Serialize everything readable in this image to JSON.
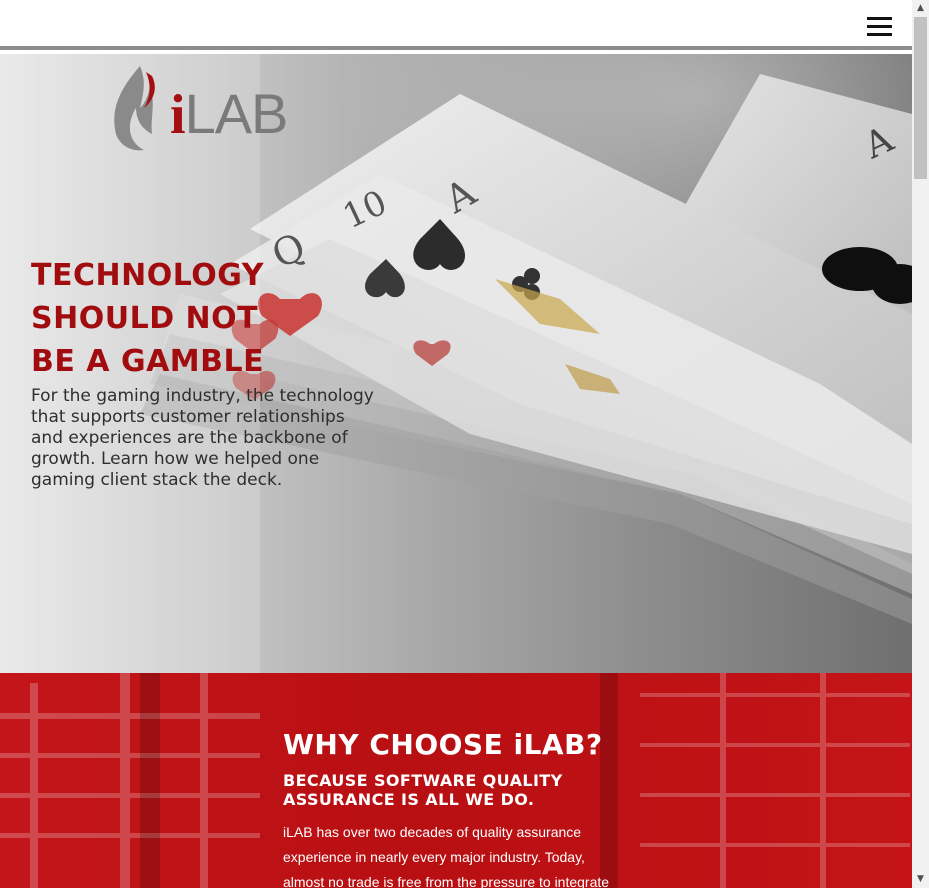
{
  "header": {
    "menu_icon": "hamburger-menu-icon"
  },
  "hero": {
    "logo": {
      "brand_prefix": "i",
      "brand_rest": "LAB",
      "flame_icon": "flame-icon"
    },
    "title_lines": [
      "TECHNOLOGY",
      "SHOULD NOT",
      "BE A GAMBLE"
    ],
    "body": "For the gaming industry, the technology that supports customer relationships and experiences are the backbone of growth. Learn how we helped one gaming client stack the deck.",
    "accent_color": "#a10d0f"
  },
  "why": {
    "title": "WHY CHOOSE iLAB?",
    "subtitle": "BECAUSE SOFTWARE QUALITY ASSURANCE IS ALL WE DO.",
    "body_lines": [
      "iLAB has over two decades of quality assurance",
      "experience in nearly every major industry. Today,",
      "almost no trade is free from the pressure to integrate"
    ],
    "background_color": "#b80f13"
  },
  "scrollbar": {
    "up_arrow": "▲",
    "down_arrow": "▼"
  }
}
